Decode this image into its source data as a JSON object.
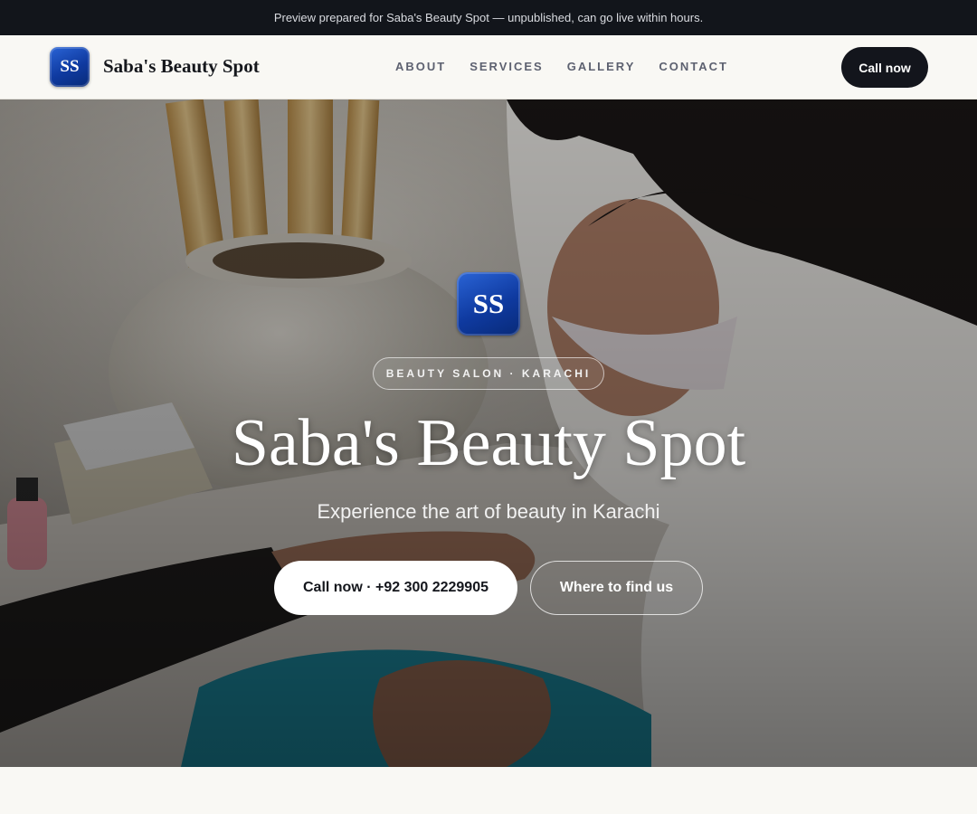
{
  "banner": {
    "text": "Preview prepared for Saba's Beauty Spot — unpublished, can go live within hours."
  },
  "header": {
    "logo_initials": "SS",
    "brand": "Saba's Beauty Spot",
    "nav": [
      "ABOUT",
      "SERVICES",
      "GALLERY",
      "CONTACT"
    ],
    "cta": "Call now"
  },
  "hero": {
    "logo_initials": "SS",
    "eyebrow": "BEAUTY SALON · KARACHI",
    "title": "Saba's Beauty Spot",
    "subtitle": "Experience the art of beauty in Karachi",
    "primary_cta": "Call now · +92 300 2229905",
    "secondary_cta": "Where to find us",
    "background_image": "photo of a beautician in a face mask doing a manicure on a client's hand"
  },
  "colors": {
    "banner_bg": "#12151b",
    "nav_bg": "#f9f8f4",
    "dark_button": "#13151c",
    "logo_blue": "#0f3aa0"
  }
}
